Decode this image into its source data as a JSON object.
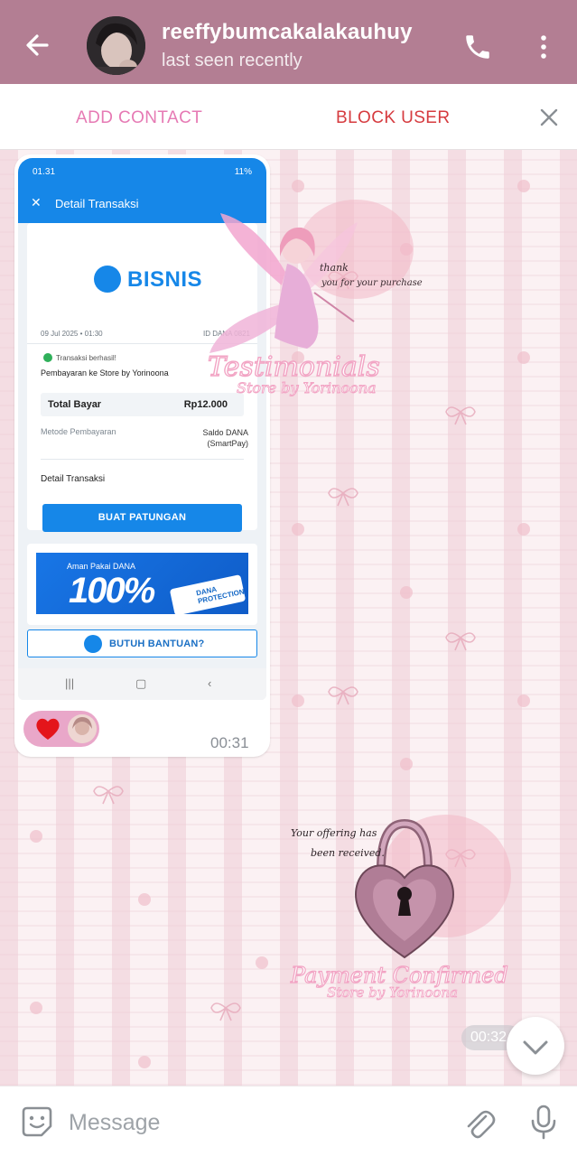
{
  "header": {
    "contact_name": "reeffybumcakalakauhuy",
    "status": "last seen recently"
  },
  "action_bar": {
    "add_contact": "ADD CONTACT",
    "block_user": "BLOCK USER"
  },
  "receipt": {
    "status_time": "01.31",
    "battery": "11%",
    "title": "Detail Transaksi",
    "brand": "BISNIS",
    "date": "09 Jul 2025 • 01:30",
    "dana_id": "ID DANA 0821",
    "success": "Transaksi berhasil!",
    "payee": "Pembayaran ke Store by Yorinoona",
    "total_label": "Total Bayar",
    "total_value": "Rp12.000",
    "method_label": "Metode Pembayaran",
    "method_value_1": "Saldo DANA",
    "method_value_2": "(SmartPay)",
    "detail_label": "Detail Transaksi",
    "patungan_button": "BUAT PATUNGAN",
    "banner_small": "Aman Pakai DANA",
    "banner_big": "100%",
    "banner_protection": "DANA PROTECTION",
    "help_button": "BUTUH BANTUAN?"
  },
  "image_message": {
    "time": "00:31"
  },
  "testimonial_sticker": {
    "thanks_1": "thank",
    "thanks_2": "you for your purchase",
    "title": "Testimonials",
    "subtitle": "Store by Yorinoona"
  },
  "payment_sticker": {
    "note_1": "Your offering has",
    "note_2": "been received.",
    "title": "Payment Confirmed",
    "subtitle": "Store by Yorinoona",
    "time": "00:32"
  },
  "composer": {
    "placeholder": "Message"
  },
  "colors": {
    "header": "#b37e93",
    "add_contact": "#e67ab4",
    "block_user": "#d63b3f",
    "dana_blue": "#1687e8"
  },
  "icons": [
    "back-arrow-icon",
    "phone-icon",
    "more-vert-icon",
    "close-icon",
    "heart-icon",
    "chevron-down-icon",
    "sticker-emoji-icon",
    "paperclip-icon",
    "microphone-icon"
  ]
}
